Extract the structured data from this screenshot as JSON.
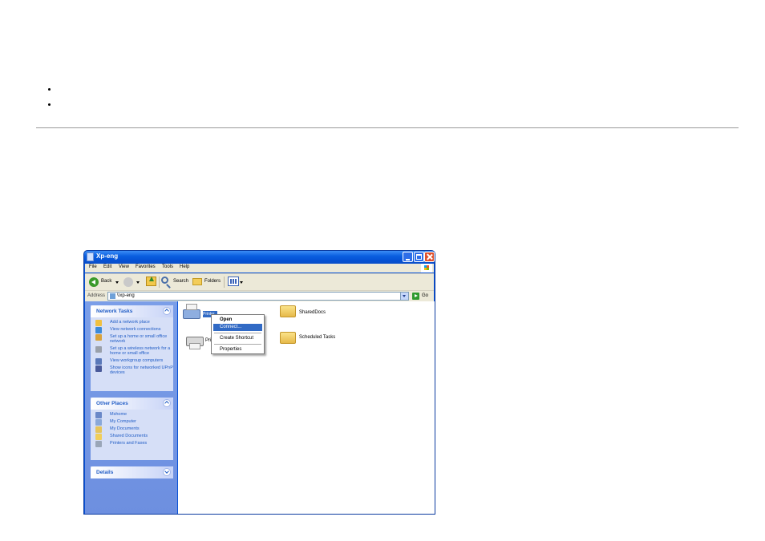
{
  "page": {
    "bullets": [
      "",
      ""
    ]
  },
  "window": {
    "title": "Xp-eng",
    "menu": [
      "File",
      "Edit",
      "View",
      "Favorites",
      "Tools",
      "Help"
    ],
    "toolbar": {
      "back_label": "Back",
      "search_label": "Search",
      "folders_label": "Folders"
    },
    "address": {
      "label": "Address",
      "value": "\\\\xp-eng",
      "go_label": "Go"
    },
    "network_tasks": {
      "title": "Network Tasks",
      "items": [
        "Add a network place",
        "View network connections",
        "Set up a home or small office network",
        "Set up a wireless network for a home or small office",
        "View workgroup computers",
        "Show icons for networked UPnP devices"
      ]
    },
    "other_places": {
      "title": "Other Places",
      "items": [
        "Mshome",
        "My Computer",
        "My Documents",
        "Shared Documents",
        "Printers and Faxes"
      ]
    },
    "details": {
      "title": "Details"
    },
    "files": {
      "printer_selected": "Printer",
      "printer2": "Printers",
      "shared_docs": "SharedDocs",
      "scheduled_tasks": "Scheduled Tasks"
    },
    "context_menu": [
      "Open",
      "Connect...",
      "Create Shortcut",
      "Properties"
    ]
  },
  "colors": {
    "title_blue": "#0a5fe0",
    "task_link": "#215dc6",
    "selection": "#316ac5"
  }
}
